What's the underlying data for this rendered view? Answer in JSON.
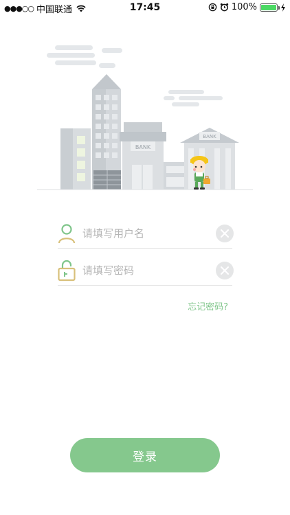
{
  "status_bar": {
    "signal": "●●●○○",
    "carrier": "中国联通",
    "time": "17:45",
    "battery": "100%",
    "battery_color": "#4cd964"
  },
  "illustration": {
    "bank_sign_1": "BANK",
    "bank_sign_2": "BANK"
  },
  "form": {
    "username_placeholder": "请填写用户名",
    "password_placeholder": "请填写密码",
    "username_icon": "user-icon",
    "password_icon": "unlock-icon",
    "clear_icon": "close-icon"
  },
  "forgot_password": "忘记密码?",
  "login_button": "登录",
  "colors": {
    "accent": "#85c88d",
    "link": "#7fc58a",
    "icon_gold": "#d8c07a"
  }
}
